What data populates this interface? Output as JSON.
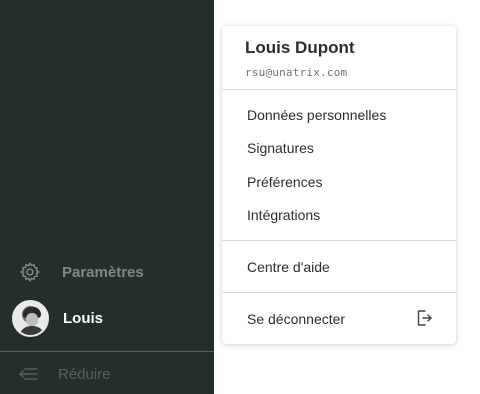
{
  "sidebar": {
    "settings": {
      "label": "Paramètres",
      "icon": "gear-icon"
    },
    "user": {
      "label": "Louis",
      "icon": "avatar"
    },
    "collapse": {
      "label": "Réduire",
      "icon": "collapse-sidebar-icon"
    },
    "colors": {
      "background": "#232f2d"
    }
  },
  "menu": {
    "name": "Louis Dupont",
    "email": "rsu@unatrix.com",
    "items": [
      {
        "label": "Données personnelles"
      },
      {
        "label": "Signatures"
      },
      {
        "label": "Préférences"
      },
      {
        "label": "Intégrations"
      }
    ],
    "help": {
      "label": "Centre d'aide"
    },
    "logout": {
      "label": "Se déconnecter",
      "icon": "logout-icon"
    }
  }
}
